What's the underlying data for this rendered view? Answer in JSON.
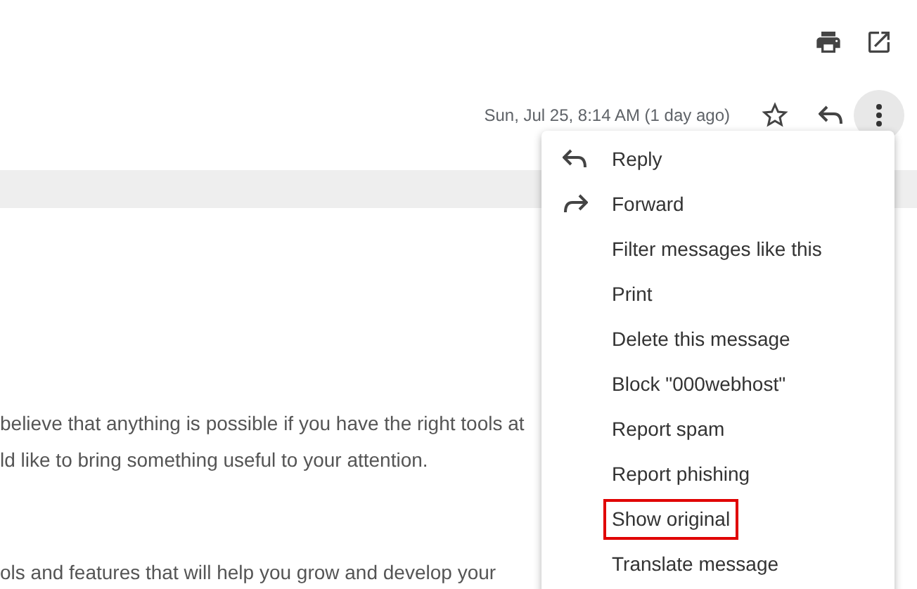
{
  "toolbar": {
    "date": "Sun, Jul 25, 8:14 AM (1 day ago)"
  },
  "menu": {
    "open": true,
    "items": [
      {
        "label": "Reply",
        "kind": "reply",
        "highlighted": false
      },
      {
        "label": "Forward",
        "kind": "forward",
        "highlighted": false
      },
      {
        "label": "Filter messages like this",
        "kind": "plain",
        "highlighted": false
      },
      {
        "label": "Print",
        "kind": "plain",
        "highlighted": false
      },
      {
        "label": "Delete this message",
        "kind": "plain",
        "highlighted": false
      },
      {
        "label": "Block \"000webhost\"",
        "kind": "plain",
        "highlighted": false
      },
      {
        "label": "Report spam",
        "kind": "plain",
        "highlighted": false
      },
      {
        "label": "Report phishing",
        "kind": "plain",
        "highlighted": false
      },
      {
        "label": "Show original",
        "kind": "plain",
        "highlighted": true
      },
      {
        "label": "Translate message",
        "kind": "plain",
        "highlighted": false
      }
    ]
  },
  "body": {
    "lines": [
      "believe that anything is possible if you have the right tools at",
      "ld like to bring something useful to your attention.",
      "ols and features that will help you grow and develop your"
    ]
  }
}
